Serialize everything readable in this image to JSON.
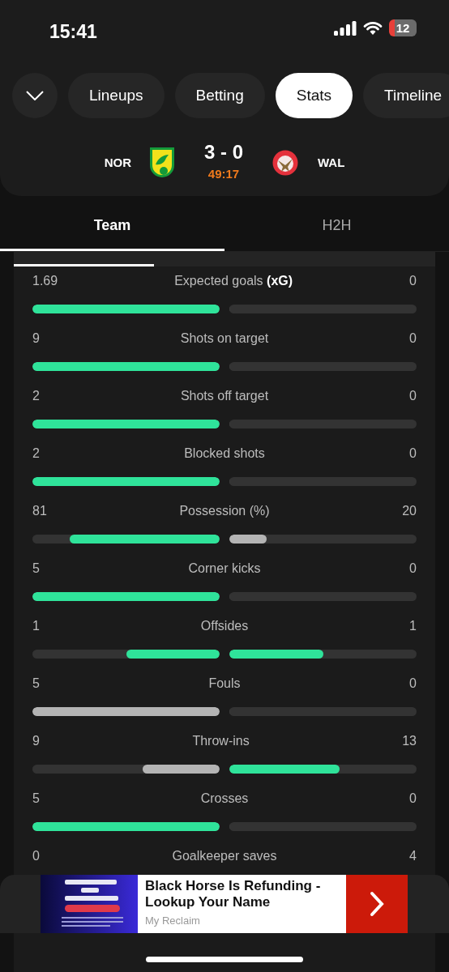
{
  "status_bar": {
    "time": "15:41",
    "battery": "12"
  },
  "tabs": [
    {
      "label": "Lineups",
      "selected": false
    },
    {
      "label": "Betting",
      "selected": false
    },
    {
      "label": "Stats",
      "selected": true
    },
    {
      "label": "Timeline",
      "selected": false
    }
  ],
  "match": {
    "home": "NOR",
    "score": "3 - 0",
    "clock": "49:17",
    "away": "WAL"
  },
  "subtabs": [
    {
      "label": "Team",
      "selected": true
    },
    {
      "label": "H2H",
      "selected": false
    }
  ],
  "stats": [
    {
      "label": "Expected goals **(xG)**",
      "home": "1.69",
      "away": "0",
      "bars": [
        {
          "level": 1,
          "color": "#2fe39a"
        },
        {
          "level": 0
        }
      ]
    },
    {
      "label": "Shots on target",
      "home": "9",
      "away": "0",
      "bars": [
        {
          "level": 1,
          "color": "#2fe39a"
        },
        {
          "level": 0
        }
      ]
    },
    {
      "label": "Shots off target",
      "home": "2",
      "away": "0",
      "bars": [
        {
          "level": 1,
          "color": "#2fe39a"
        },
        {
          "level": 0
        }
      ]
    },
    {
      "label": "Blocked shots",
      "home": "2",
      "away": "0",
      "bars": [
        {
          "level": 1,
          "color": "#2fe39a"
        },
        {
          "level": 0
        }
      ]
    },
    {
      "label": "Possession (%)",
      "home": "81",
      "away": "20",
      "bars": [
        {
          "level": 0.8,
          "color": "#2fe39a"
        },
        {
          "level": 0.2,
          "color": "#b4b4b4"
        }
      ]
    },
    {
      "label": "Corner kicks",
      "home": "5",
      "away": "0",
      "bars": [
        {
          "level": 1,
          "color": "#2fe39a"
        },
        {
          "level": 0
        }
      ]
    },
    {
      "label": "Offsides",
      "home": "1",
      "away": "1",
      "bars": [
        {
          "level": 0.5,
          "color": "#2fe39a"
        },
        {
          "level": 0.5,
          "color": "#2fe39a"
        }
      ]
    },
    {
      "label": "Fouls",
      "home": "5",
      "away": "0",
      "bars": [
        {
          "level": 1,
          "color": "#b4b4b4"
        },
        {
          "level": 0
        }
      ]
    },
    {
      "label": "Throw-ins",
      "home": "9",
      "away": "13",
      "bars": [
        {
          "level": 0.41,
          "color": "#b4b4b4"
        },
        {
          "level": 0.59,
          "color": "#2fe39a"
        }
      ]
    },
    {
      "label": "Crosses",
      "home": "5",
      "away": "0",
      "bars": [
        {
          "level": 1,
          "color": "#2fe39a"
        },
        {
          "level": 0
        }
      ]
    },
    {
      "label": "Goalkeeper saves",
      "home": "0",
      "away": "4"
    }
  ],
  "ad": {
    "headline": "Black Horse Is Refunding - Lookup Your Name",
    "source": "My Reclaim"
  }
}
